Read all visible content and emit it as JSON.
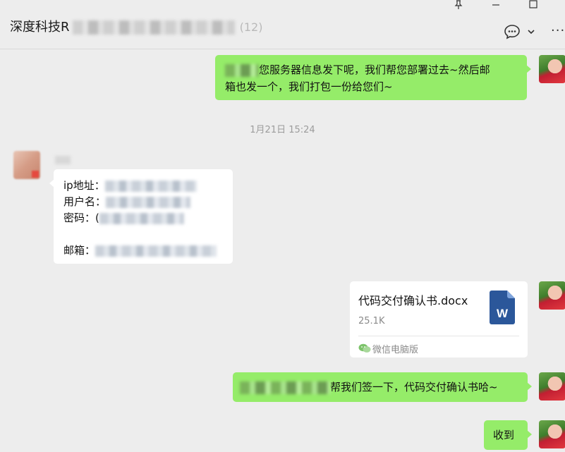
{
  "header": {
    "title": "深度科技R",
    "title_suffix": " (12)",
    "window_controls": [
      "pin-icon",
      "minimize-icon",
      "maximize-icon"
    ],
    "actions": [
      "chat-bubble-icon",
      "chevron-down-icon",
      "more-icon"
    ]
  },
  "messages": [
    {
      "side": "right",
      "text": "您服务器信息发下呢，我们帮您部署过去~然后邮箱也发一个，我们打包一份给您们~",
      "line1": "您服务器信息发下呢，我们帮您部署过去~然后邮",
      "line2": "箱也发一个，我们打包一份给您们~"
    },
    {
      "type": "timestamp",
      "text": "1月21日 15:24"
    },
    {
      "side": "left",
      "fields": {
        "ip_label": "ip地址：",
        "user_label": "用户名：",
        "password_label": "密码：",
        "password_prefix": "(",
        "email_label": "邮箱："
      }
    },
    {
      "side": "right",
      "type": "file",
      "file_name": "代码交付确认书.docx",
      "file_size": "25.1K",
      "source": "微信电脑版",
      "file_icon_letter": "W"
    },
    {
      "side": "right",
      "text": "帮我们签一下，代码交付确认书哈~"
    },
    {
      "side": "right",
      "text": "收到"
    }
  ],
  "colors": {
    "background": "#ededed",
    "bubble_self": "#95ec69",
    "bubble_other": "#ffffff",
    "word_blue": "#2b579a"
  }
}
